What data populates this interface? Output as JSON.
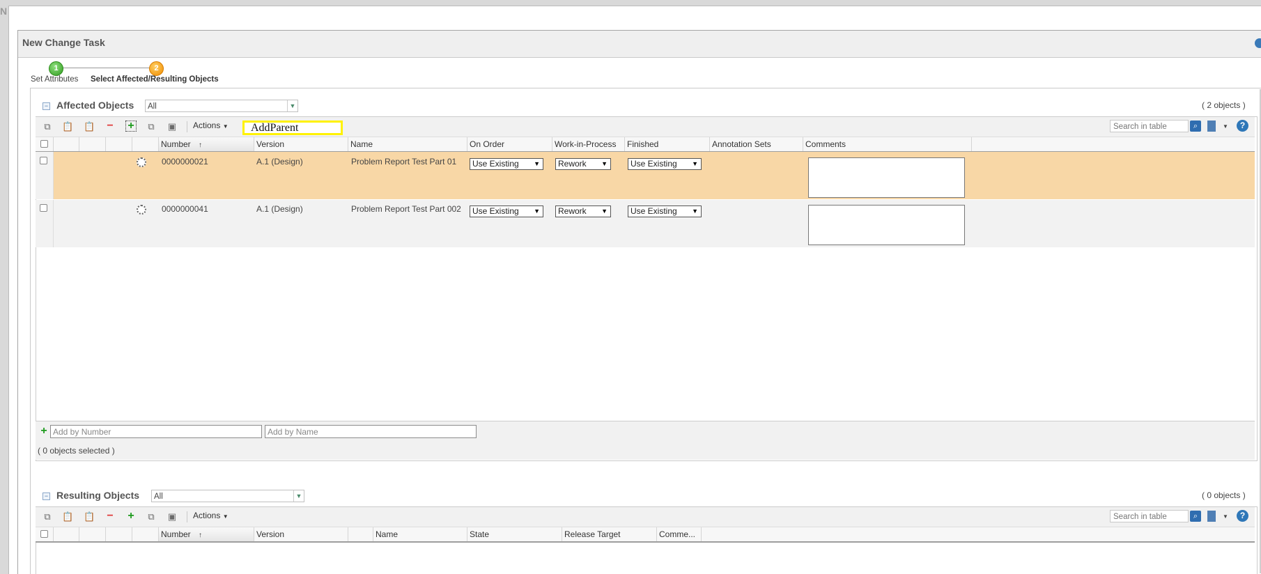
{
  "background_text": "N",
  "dialog": {
    "title": "New Change Task"
  },
  "wizard": {
    "steps": [
      {
        "number": "1",
        "label": "Set Attributes"
      },
      {
        "number": "2",
        "label": "Select Affected/Resulting Objects"
      }
    ]
  },
  "affected": {
    "title": "Affected Objects",
    "filter": "All",
    "count": "( 2 objects )",
    "actions_label": "Actions",
    "search_placeholder": "Search in table",
    "columns": [
      "Number",
      "Version",
      "Name",
      "On Order",
      "Work-in-Process",
      "Finished",
      "Annotation Sets",
      "Comments"
    ],
    "rows": [
      {
        "number": "0000000021",
        "version": "A.1 (Design)",
        "name": "Problem Report Test Part 01",
        "on_order": "Use Existing",
        "wip": "Rework",
        "finished": "Use Existing"
      },
      {
        "number": "0000000041",
        "version": "A.1 (Design)",
        "name": "Problem Report Test Part 002",
        "on_order": "Use Existing",
        "wip": "Rework",
        "finished": "Use Existing"
      }
    ],
    "add_by_number_placeholder": "Add by Number",
    "add_by_name_placeholder": "Add by Name",
    "selected_count": "( 0 objects selected )"
  },
  "resulting": {
    "title": "Resulting Objects",
    "filter": "All",
    "count": "( 0 objects )",
    "actions_label": "Actions",
    "search_placeholder": "Search in table",
    "columns": [
      "Number",
      "Version",
      "Name",
      "State",
      "Release Target",
      "Comme..."
    ]
  },
  "annotation": {
    "label": "AddParent",
    "color": "#fff200"
  },
  "icons": {
    "copy": "copy-icon",
    "paste": "paste-icon",
    "paste-select": "paste-select-icon",
    "remove": "remove-icon",
    "add": "add-icon",
    "gear": "gear-icon",
    "help": "help-icon"
  }
}
